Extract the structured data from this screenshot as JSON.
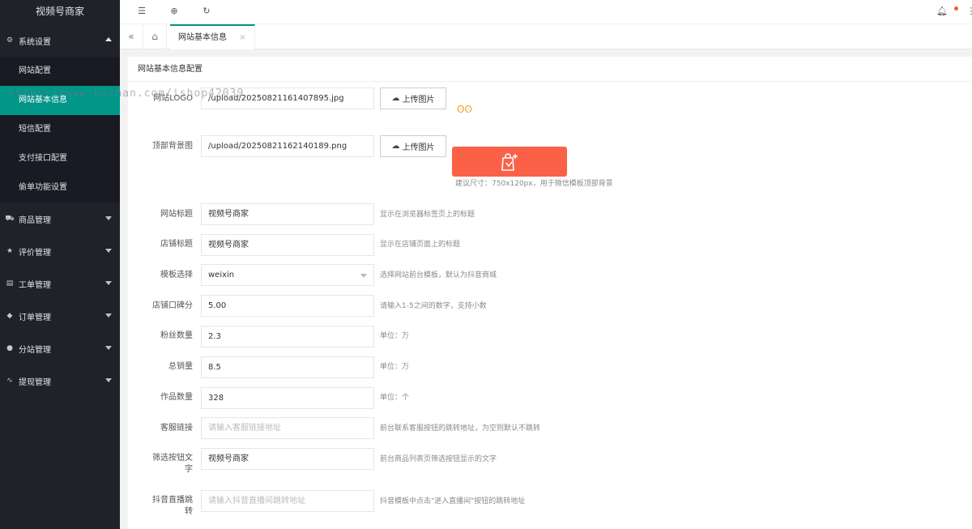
{
  "sidebar": {
    "logo": "视频号商家",
    "menu": [
      {
        "label": "系统设置",
        "icon": "gear-icon"
      },
      {
        "label": "商品管理",
        "icon": "cart-icon"
      },
      {
        "label": "评价管理",
        "icon": "star-icon"
      },
      {
        "label": "工单管理",
        "icon": "ticket-icon"
      },
      {
        "label": "订单管理",
        "icon": "box-icon"
      },
      {
        "label": "分站管理",
        "icon": "globe-icon"
      },
      {
        "label": "提现管理",
        "icon": "pulse-icon"
      }
    ],
    "submenu": [
      "网站配置",
      "网站基本信息",
      "短信配置",
      "支付接口配置",
      "偷单功能设置"
    ]
  },
  "tabs": {
    "active": "网站基本信息",
    "close": "×"
  },
  "card": {
    "title": "网站基本信息配置"
  },
  "form": {
    "logo": {
      "label": "网站LOGO",
      "value": "/upload/20250821161407895.jpg",
      "button": "上传图片"
    },
    "bg": {
      "label": "顶部背景图",
      "value": "/upload/20250821162140189.png",
      "button": "上传图片",
      "tip": "建议尺寸：750x120px，用于微信模板顶部背景"
    },
    "site_title": {
      "label": "网站标题",
      "value": "视频号商家",
      "tip": "显示在浏览器标签页上的标题"
    },
    "shop_title": {
      "label": "店铺标题",
      "value": "视频号商家",
      "tip": "显示在店铺页面上的标题"
    },
    "template": {
      "label": "模板选择",
      "value": "weixin",
      "tip": "选择网站前台模板，默认为抖音商城"
    },
    "score": {
      "label": "店铺口碑分",
      "value": "5.00",
      "tip": "请输入1-5之间的数字，支持小数"
    },
    "fans": {
      "label": "粉丝数量",
      "value": "2.3",
      "tip": "单位：万"
    },
    "sales": {
      "label": "总销量",
      "value": "8.5",
      "tip": "单位：万"
    },
    "works": {
      "label": "作品数量",
      "value": "328",
      "tip": "单位：个"
    },
    "service": {
      "label": "客服链接",
      "placeholder": "请输入客服链接地址",
      "tip": "前台联系客服按钮的跳转地址，为空则默认不跳转"
    },
    "filter": {
      "label": "筛选按钮文字",
      "value": "视频号商家",
      "tip": "前台商品列表页筛选按钮显示的文字"
    },
    "live": {
      "label": "抖音直播跳转",
      "placeholder": "请输入抖音直播间跳转地址",
      "tip": "抖音模板中点击\"进入直播间\"按钮的跳转地址"
    }
  },
  "watermark": "https://www.huzhan.com/ishop42039"
}
